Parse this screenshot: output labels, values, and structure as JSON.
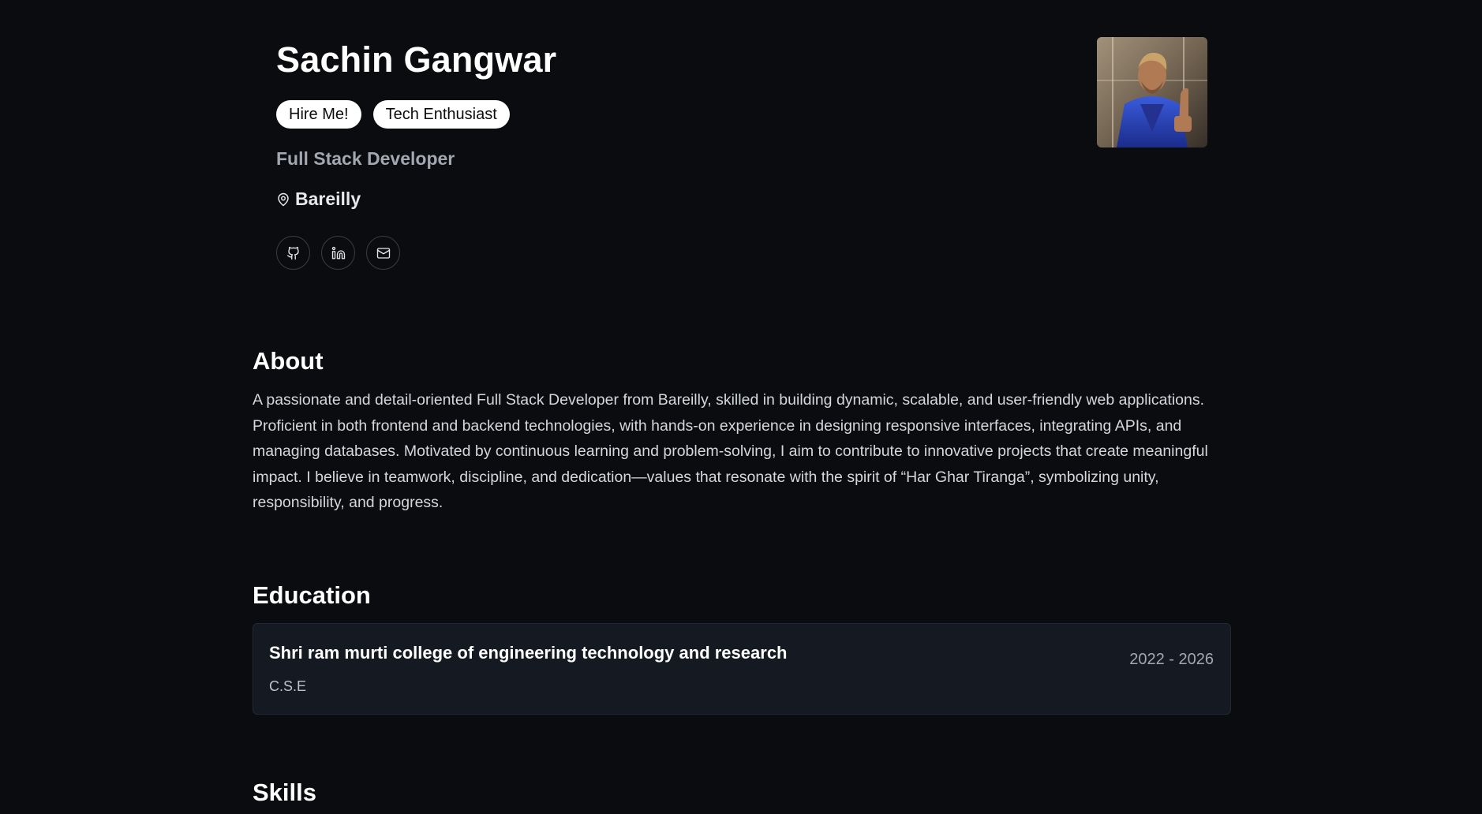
{
  "profile": {
    "name": "Sachin Gangwar",
    "badges": [
      "Hire Me!",
      "Tech Enthusiast"
    ],
    "role": "Full Stack Developer",
    "location": "Bareilly",
    "socials": [
      {
        "icon": "github-icon"
      },
      {
        "icon": "linkedin-icon"
      },
      {
        "icon": "mail-icon"
      }
    ]
  },
  "about": {
    "title": "About",
    "text": "A passionate and detail-oriented Full Stack Developer from Bareilly, skilled in building dynamic, scalable, and user-friendly web applications. Proficient in both frontend and backend technologies, with hands-on experience in designing responsive interfaces, integrating APIs, and managing databases. Motivated by continuous learning and problem-solving, I aim to contribute to innovative projects that create meaningful impact. I believe in teamwork, discipline, and dedication—values that resonate with the spirit of “Har Ghar Tiranga”, symbolizing unity, responsibility, and progress."
  },
  "education": {
    "title": "Education",
    "items": [
      {
        "school": "Shri ram murti college of engineering technology and research",
        "degree": "C.S.E",
        "years": "2022 - 2026"
      }
    ]
  },
  "skills": {
    "title": "Skills"
  },
  "colors": {
    "background": "#0b0c0f",
    "card": "#141922",
    "muted": "#a3a7b0"
  }
}
